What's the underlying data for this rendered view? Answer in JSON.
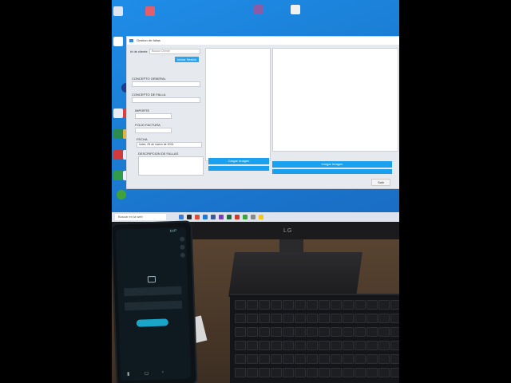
{
  "desktop": {
    "icon_colors": [
      "#e35d6a",
      "#f0f0f0",
      "#3a7ddd",
      "#ffffff"
    ],
    "icon_label_recycle": "",
    "icon_label_excel": ""
  },
  "app_window": {
    "title": "Gestion de fallas",
    "search_label": "Id de cliente",
    "search_placeholder": "Buscar Cliente",
    "search_button": "Iniciar Sesión",
    "concepto_general_label": "CONCEPTO GENERAL",
    "concepto_detalle_label": "CONCEPTO DE FALLA",
    "importe_label": "IMPORTE",
    "folio_label": "FOLIO FACTURA",
    "fecha_label": "FECHA",
    "fecha_value": "lunes, 25 de marzo de 2024",
    "descripcion_label": "DESCRIPCION DE FALLAS",
    "left_panel_button": "Cargar Imagen",
    "right_panel_button": "Cargar Imagen",
    "salir_button": "Salir"
  },
  "taskbar": {
    "search_placeholder": "Buscar en la web"
  },
  "monitor_brand": "LG",
  "phone": {
    "status_time": "11:27",
    "header": "",
    "message_line1": "",
    "message_line2": "",
    "action_button": ""
  }
}
